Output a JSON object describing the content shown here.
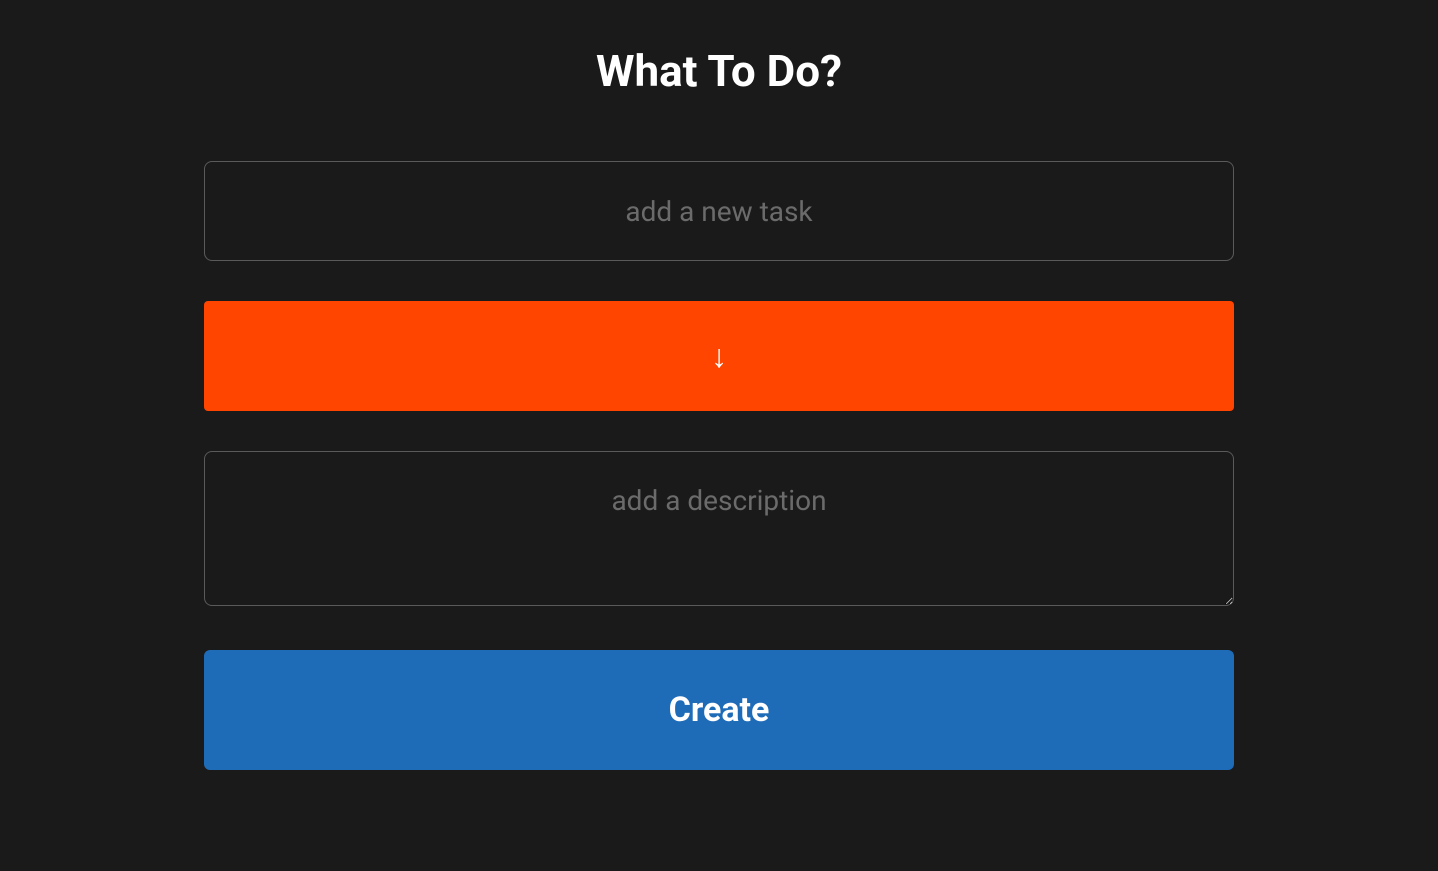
{
  "header": {
    "title": "What To Do?"
  },
  "form": {
    "task_input": {
      "value": "",
      "placeholder": "add a new task"
    },
    "arrow_symbol": "↓",
    "description_input": {
      "value": "",
      "placeholder": "add a description"
    },
    "create_button_label": "Create"
  },
  "colors": {
    "background": "#1a1a1a",
    "accent_orange": "#ff4500",
    "accent_blue": "#1e6bb8",
    "border": "#5a5a5a",
    "placeholder": "#6b6b6b"
  }
}
